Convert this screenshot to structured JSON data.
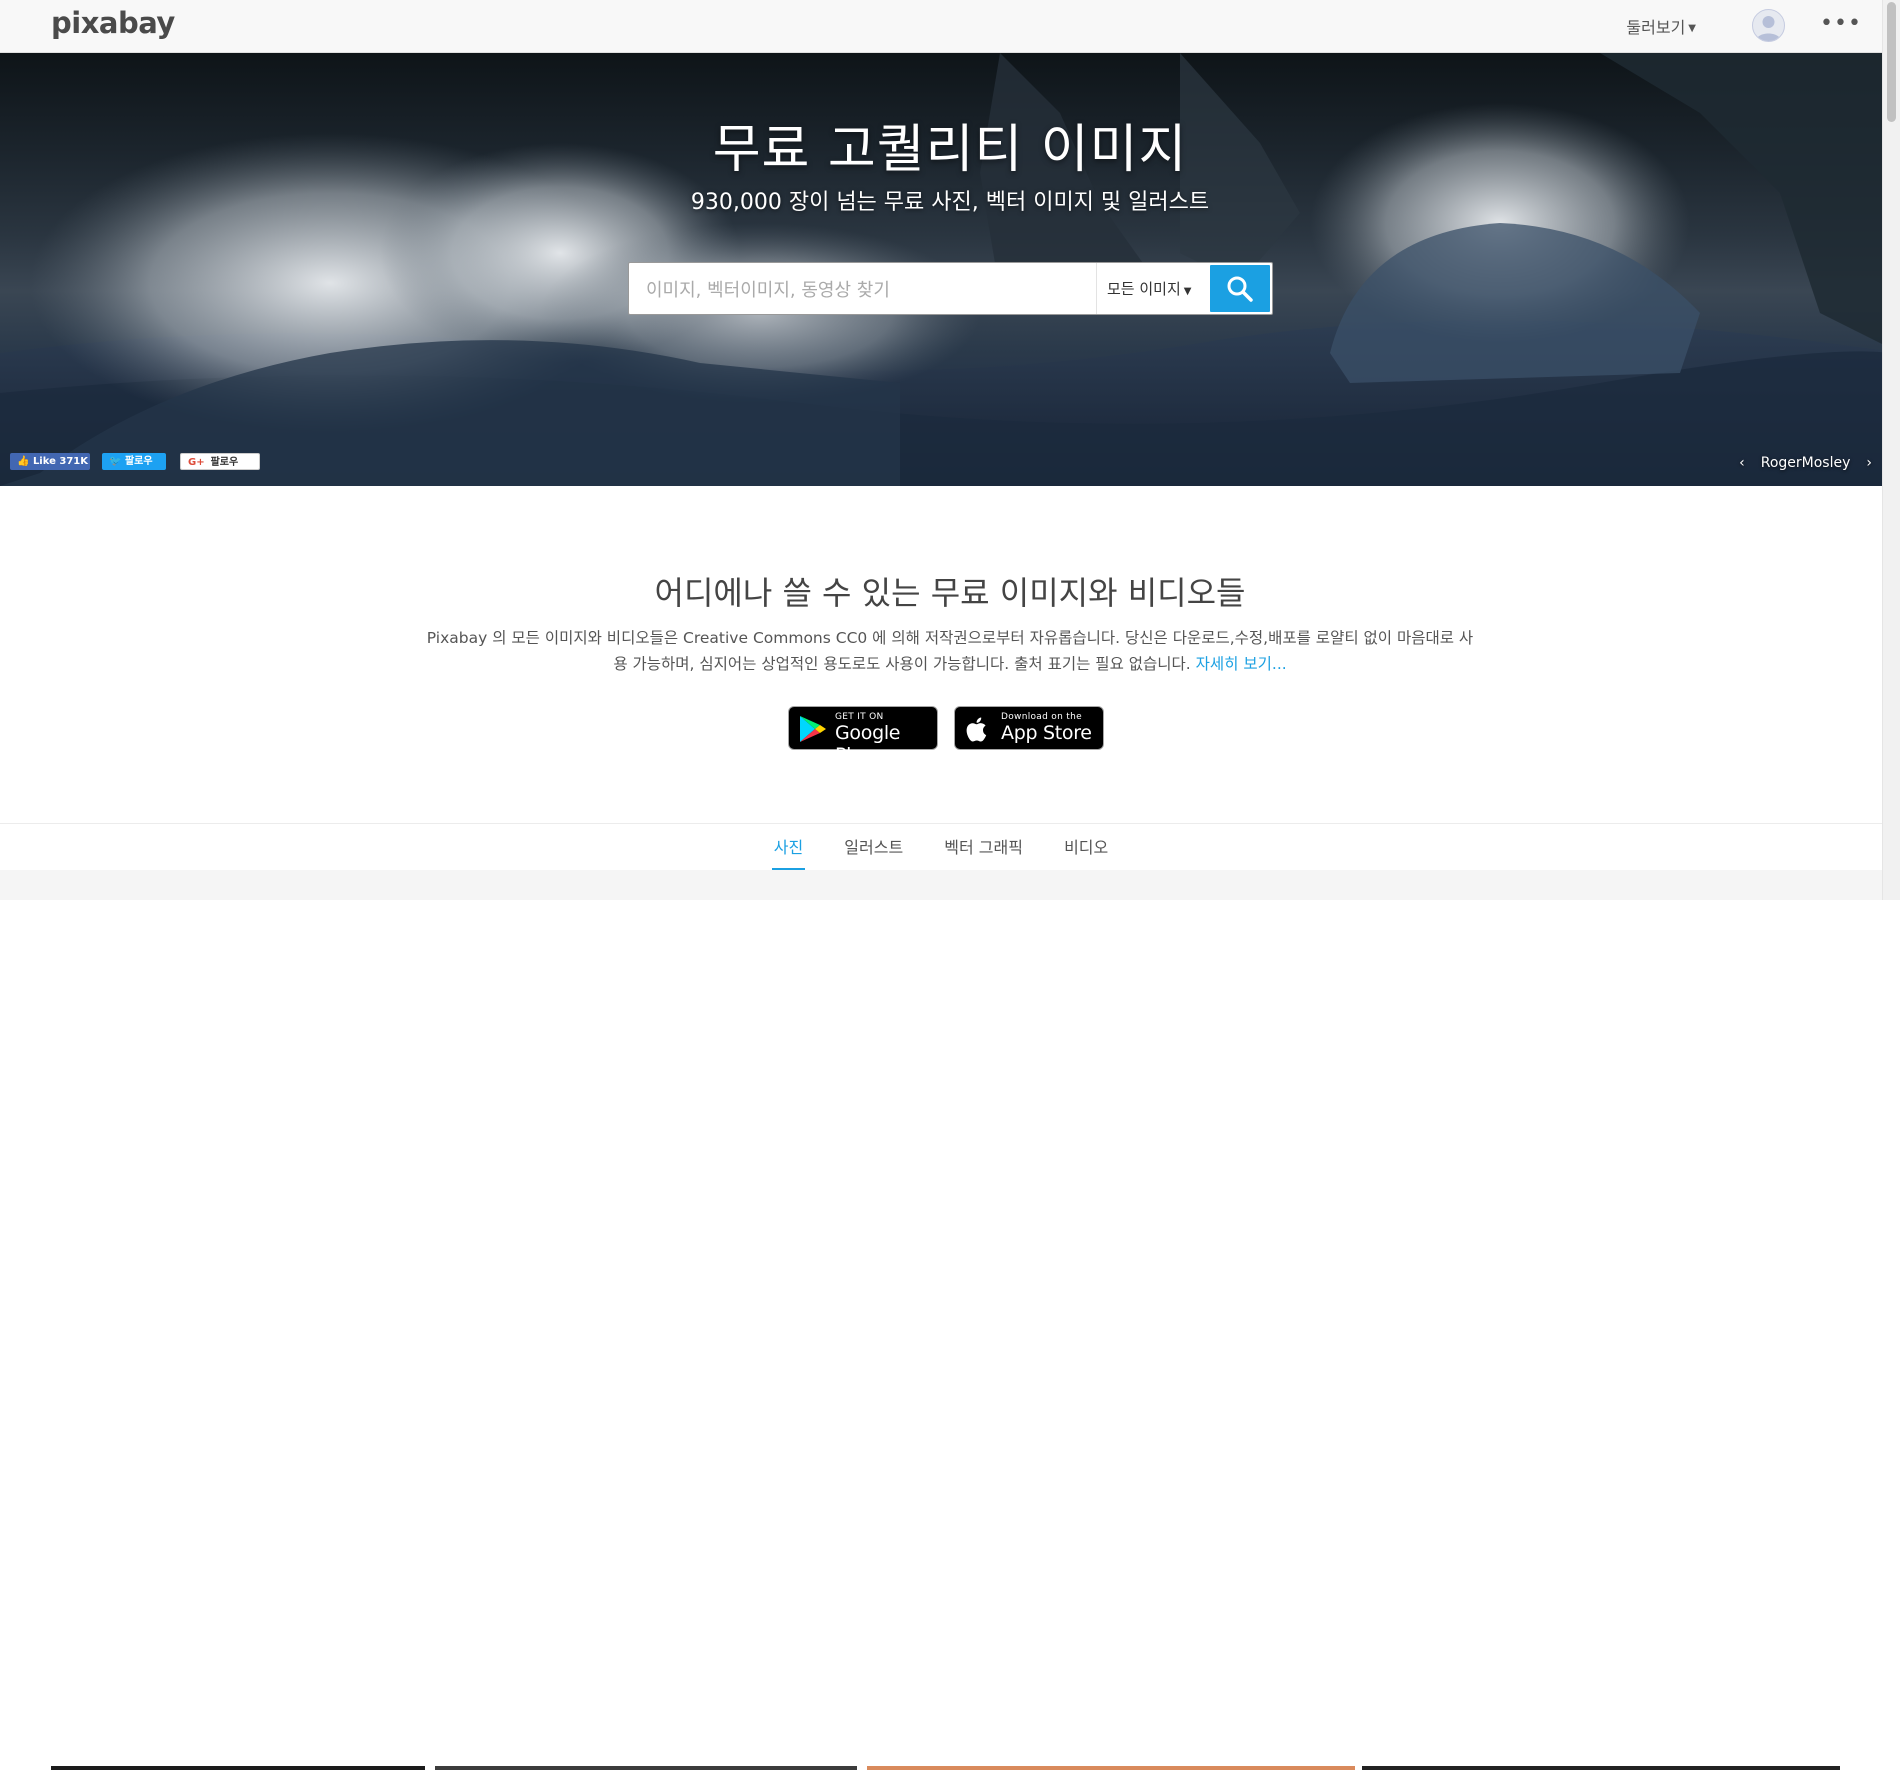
{
  "header": {
    "logo": "pixabay",
    "explore_label": "둘러보기",
    "more_label": "•••"
  },
  "hero": {
    "title": "무료 고퀄리티 이미지",
    "subtitle": "930,000 장이 넘는 무료 사진, 벡터 이미지 및 일러스트",
    "search": {
      "placeholder": "이미지, 벡터이미지, 동영상 찾기",
      "type_label": "모든 이미지"
    },
    "social": {
      "facebook": "Like 371K",
      "twitter": "팔로우",
      "google": "팔로우"
    },
    "credit": "RogerMosley"
  },
  "intro": {
    "title": "어디에나 쓸 수 있는 무료 이미지와 비디오들",
    "body": "Pixabay 의 모든 이미지와 비디오들은 Creative Commons CC0 에 의해 저작권으로부터 자유롭습니다. 당신은 다운로드,수정,배포를 로얄티 없이 마음대로 사용 가능하며, 심지어는 상업적인 용도로도 사용이 가능합니다. 출처 표기는 필요 없습니다.",
    "more_link": "자세히 보기...",
    "google_play": {
      "small": "GET IT ON",
      "big": "Google Play"
    },
    "app_store": {
      "small": "Download on the",
      "big": "App Store"
    }
  },
  "tabs": [
    {
      "label": "사진",
      "active": true
    },
    {
      "label": "일러스트",
      "active": false
    },
    {
      "label": "벡터 그래픽",
      "active": false
    },
    {
      "label": "비디오",
      "active": false
    }
  ],
  "colors": {
    "accent": "#1ba0e2",
    "facebook": "#4267b2",
    "twitter": "#1da1f2"
  }
}
